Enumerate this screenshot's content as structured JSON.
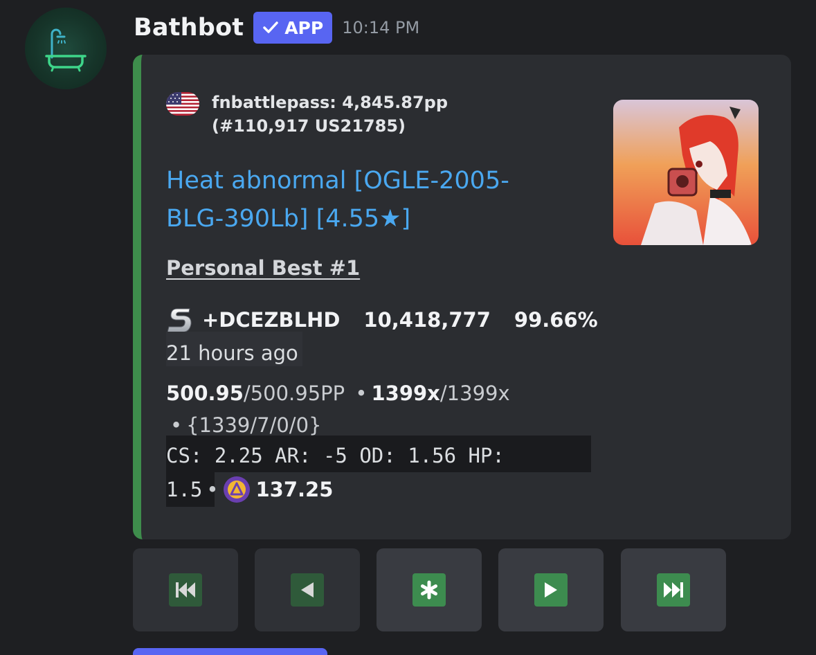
{
  "message": {
    "author": "Bathbot",
    "badge": "APP",
    "timestamp": "10:14 PM",
    "avatar_icon": "bathtub-shower-icon"
  },
  "embed": {
    "accent_color": "#3e8d4c",
    "author_text": "fnbattlepass: 4,845.87pp (#110,917 US21785)",
    "flag_icon": "us-flag-icon",
    "title": "Heat abnormal [OGLE-2005-BLG-390Lb] [4.55★]",
    "field_name": "Personal Best #1",
    "grade_icon": "grade-s-icon",
    "mods": "+DCEZBLHD",
    "score": "10,418,777",
    "accuracy": "99.66%",
    "time_ago": "21 hours ago",
    "pp_value": "500.95",
    "pp_max": "/500.95PP",
    "sep1": "•",
    "combo": "1399x",
    "combo_max": "/1399x",
    "sep2": "•",
    "hits": "{1339/7/0/0}",
    "stats_line1": "CS: 2.25 AR: -5 OD: 1.56 HP:",
    "stats_line2": "1.5",
    "sep3": "•",
    "star_icon": "difficulty-star-icon",
    "stars": "137.25"
  },
  "buttons": [
    {
      "name": "first-page-button",
      "icon": "track-previous-icon",
      "enabled": false
    },
    {
      "name": "previous-page-button",
      "icon": "arrow-backward-icon",
      "enabled": false
    },
    {
      "name": "jump-page-button",
      "icon": "asterisk-icon",
      "enabled": true
    },
    {
      "name": "next-page-button",
      "icon": "arrow-forward-icon",
      "enabled": true
    },
    {
      "name": "last-page-button",
      "icon": "track-next-icon",
      "enabled": true
    }
  ]
}
